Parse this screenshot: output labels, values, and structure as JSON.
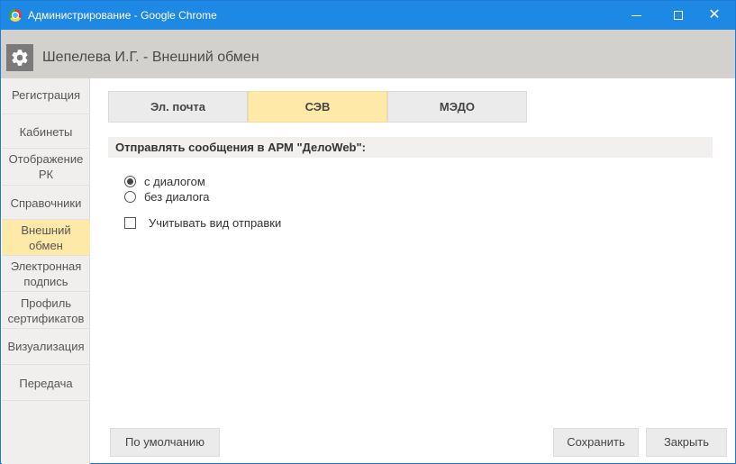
{
  "window": {
    "title": "Администрирование - Google Chrome",
    "minimize_glyph": "—",
    "close_glyph": "✕"
  },
  "header": {
    "title": "Шепелева И.Г. - Внешний обмен",
    "icon": "gear-icon"
  },
  "sidebar": {
    "items": [
      {
        "lines": [
          "Регистрация"
        ]
      },
      {
        "lines": [
          "Кабинеты"
        ]
      },
      {
        "lines": [
          "Отображение",
          "РК"
        ]
      },
      {
        "lines": [
          "Справочники"
        ]
      },
      {
        "lines": [
          "Внешний",
          "обмен"
        ],
        "active": true
      },
      {
        "lines": [
          "Электронная",
          "подпись"
        ]
      },
      {
        "lines": [
          "Профиль",
          "сертификатов"
        ]
      },
      {
        "lines": [
          "Визуализация"
        ]
      },
      {
        "lines": [
          "Передача"
        ]
      }
    ]
  },
  "tabs": [
    {
      "label": "Эл. почта"
    },
    {
      "label": "СЭВ",
      "active": true
    },
    {
      "label": "МЭДО"
    }
  ],
  "section": {
    "title": "Отправлять сообщения в АРМ \"ДелоWeb\":"
  },
  "options": {
    "radio_with_dialog": "с диалогом",
    "radio_without_dialog": "без диалога",
    "selected": "с диалогом",
    "checkbox_label": "Учитывать вид отправки",
    "checkbox_checked": false
  },
  "buttons": {
    "default": "По умолчанию",
    "save": "Сохранить",
    "close": "Закрыть"
  },
  "colors": {
    "titlebar": "#1e88e5",
    "header": "#d3d1cd",
    "active_highlight": "#ffe9a8",
    "sidebar": "#f0efed"
  }
}
